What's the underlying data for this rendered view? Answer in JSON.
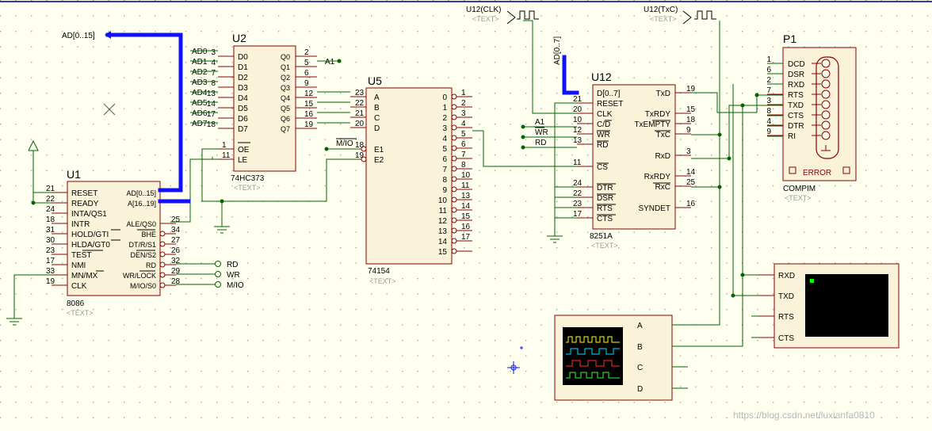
{
  "colors": {
    "background": "#fffff0",
    "body": "#fbf3d9",
    "outline": "#8b0000",
    "wire": "#006400",
    "bus": "#1010ff",
    "scope": "#000000"
  },
  "text_tag": "<TEXT>",
  "u2": {
    "ref": "U2",
    "part": "74HC373",
    "in_labels": [
      "D0",
      "D1",
      "D2",
      "D3",
      "D4",
      "D5",
      "D6",
      "D7"
    ],
    "in_pins": [
      "3",
      "4",
      "7",
      "8",
      "13",
      "14",
      "17",
      "18"
    ],
    "out_labels": [
      "Q0",
      "Q1",
      "Q2",
      "Q3",
      "Q4",
      "Q5",
      "Q6",
      "Q7"
    ],
    "out_pins": [
      "2",
      "5",
      "6",
      "9",
      "12",
      "15",
      "16",
      "19"
    ],
    "ctrl_labels": [
      "OE",
      "LE"
    ],
    "ctrl_pins": [
      "1",
      "11"
    ]
  },
  "ad_nets": [
    "AD0",
    "AD1",
    "AD2",
    "AD3",
    "AD4",
    "AD5",
    "AD6",
    "AD7"
  ],
  "a1_net": "A1",
  "ad_bus_label": "AD[0..15]",
  "u5": {
    "ref": "U5",
    "part": "74154",
    "in_labels": [
      "A",
      "B",
      "C",
      "D",
      "E1",
      "E2"
    ],
    "in_pins": [
      "23",
      "22",
      "21",
      "20",
      "18",
      "19"
    ],
    "out_labels": [
      "0",
      "1",
      "2",
      "3",
      "4",
      "5",
      "6",
      "7",
      "8",
      "9",
      "10",
      "11",
      "12",
      "13",
      "14",
      "15"
    ],
    "out_pins": [
      "1",
      "2",
      "3",
      "4",
      "5",
      "6",
      "7",
      "8",
      "10",
      "11",
      "13",
      "14",
      "15",
      "16",
      "17"
    ],
    "mio_label": "M/IO"
  },
  "u1": {
    "ref": "U1",
    "part": "8086",
    "left_labels": [
      "RESET",
      "READY",
      "INTA/QS1",
      "INTR",
      "HOLD/GTI",
      "HLDA/GT0",
      "TEST",
      "NMI",
      "MN/MX",
      "CLK"
    ],
    "left_pins": [
      "21",
      "22",
      "24",
      "18",
      "31",
      "30",
      "23",
      "17",
      "33",
      "19"
    ],
    "right_labels": [
      "AD[0..15]",
      "A[16..19]",
      "ALE/QS0",
      "BHE",
      "DT/R/S1",
      "DEN/S2",
      "RD",
      "WR/LOCK",
      "M/IO/S0"
    ],
    "right_pins": [
      "25",
      "34",
      "27",
      "26",
      "32",
      "29",
      "28"
    ],
    "out_nets": [
      "RD",
      "WR",
      "M/IO"
    ]
  },
  "u12": {
    "ref": "U12",
    "part": "8251A",
    "left_labels": [
      "D[0..7]",
      "RESET",
      "CLK",
      "C/D",
      "WR",
      "RD",
      "CS",
      "DTR",
      "DSR",
      "RTS",
      "CTS"
    ],
    "left_pins": [
      "21",
      "20",
      "10",
      "12",
      "13",
      "11",
      "24",
      "22",
      "23",
      "17"
    ],
    "right_labels": [
      "TxD",
      "TxRDY",
      "TxEMPTY",
      "TxC",
      "RxD",
      "RxRDY",
      "RxC",
      "SYNDET"
    ],
    "right_pins": [
      "19",
      "15",
      "18",
      "9",
      "3",
      "14",
      "25",
      "16"
    ],
    "nets": [
      "A1",
      "WR",
      "RD"
    ],
    "bus_label": "AD[0..7]",
    "clk_gen_label": "U12(CLK)",
    "txc_gen_label": "U12(TxC)"
  },
  "p1": {
    "ref": "P1",
    "part": "COMPIM",
    "labels": [
      "DCD",
      "DSR",
      "RXD",
      "RTS",
      "TXD",
      "CTS",
      "DTR",
      "RI"
    ],
    "pins": [
      "1",
      "6",
      "2",
      "7",
      "3",
      "8",
      "4",
      "9"
    ],
    "error": "ERROR"
  },
  "terminal": {
    "labels": [
      "RXD",
      "TXD",
      "RTS",
      "CTS"
    ]
  },
  "scope": {
    "labels": [
      "A",
      "B",
      "C",
      "D"
    ]
  },
  "watermark": "https://blog.csdn.net/luxianfa0810"
}
